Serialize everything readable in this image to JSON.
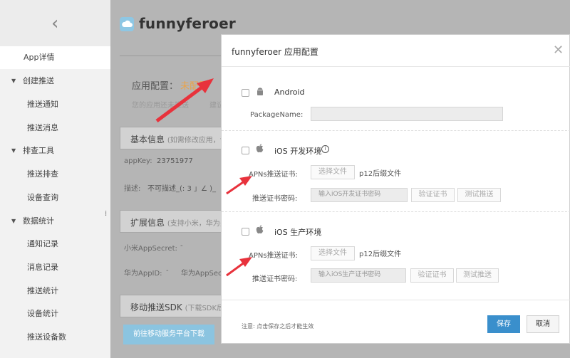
{
  "sidebar": {
    "back_icon": "chevron-left-icon",
    "items": [
      {
        "label": "App详情",
        "kind": "app"
      },
      {
        "label": "创建推送",
        "kind": "section"
      },
      {
        "label": "推送通知",
        "kind": "sub"
      },
      {
        "label": "推送消息",
        "kind": "sub"
      },
      {
        "label": "排查工具",
        "kind": "section"
      },
      {
        "label": "推送排查",
        "kind": "sub"
      },
      {
        "label": "设备查询",
        "kind": "sub"
      },
      {
        "label": "数据统计",
        "kind": "section"
      },
      {
        "label": "通知记录",
        "kind": "sub"
      },
      {
        "label": "消息记录",
        "kind": "sub"
      },
      {
        "label": "推送统计",
        "kind": "sub"
      },
      {
        "label": "设备统计",
        "kind": "sub"
      },
      {
        "label": "推送设备数",
        "kind": "sub"
      }
    ]
  },
  "main": {
    "app_name": "funnyferoer",
    "config_label": "应用配置：",
    "config_value": "未配置",
    "config_note": "您的应用还未推送",
    "config_note_tail": "建议",
    "basic": {
      "title": "基本信息",
      "hint": "(如需修改应用，请",
      "appkey_label": "appKey:",
      "appkey_value": "23751977",
      "desc_label": "描述:",
      "desc_value": "不可描述_(: 3 」∠ )_"
    },
    "ext": {
      "title": "扩展信息",
      "hint": "(支持小米，华为多",
      "xiaomi_label": "小米AppSecret:",
      "xiaomi_value": "-",
      "huawei_label": "华为AppID:",
      "huawei_value": "-",
      "huawei2_label": "华为AppSecr"
    },
    "sdk": {
      "title": "移动推送SDK",
      "hint": "(下载SDK后之",
      "download_label": "前往移动服务平台下载"
    }
  },
  "modal": {
    "title": "funnyferoer 应用配置",
    "close_icon": "close-icon",
    "android": {
      "label": "Android",
      "icon": "android-icon",
      "package_label": "PackageName:"
    },
    "ios_dev": {
      "label": "iOS 开发环境",
      "icon": "apple-icon",
      "info_icon": "info-icon",
      "cert_label": "APNs推送证书:",
      "choose_file": "选择文件",
      "cert_hint": "p12后缀文件",
      "pwd_label": "推送证书密码:",
      "pwd_placeholder": "输入iOS开发证书密码",
      "verify": "验证证书",
      "test": "测试推送"
    },
    "ios_prod": {
      "label": "iOS 生产环境",
      "icon": "apple-icon",
      "cert_label": "APNs推送证书:",
      "choose_file": "选择文件",
      "cert_hint": "p12后缀文件",
      "pwd_label": "推送证书密码:",
      "pwd_placeholder": "输入iOS生产证书密码",
      "verify": "验证证书",
      "test": "测试推送"
    },
    "footer_note": "注意: 点击保存之后才能生效",
    "save": "保存",
    "cancel": "取消"
  },
  "colors": {
    "accent": "#3a8fcc",
    "warning": "#e9a34a",
    "arrow": "#e8323c"
  }
}
